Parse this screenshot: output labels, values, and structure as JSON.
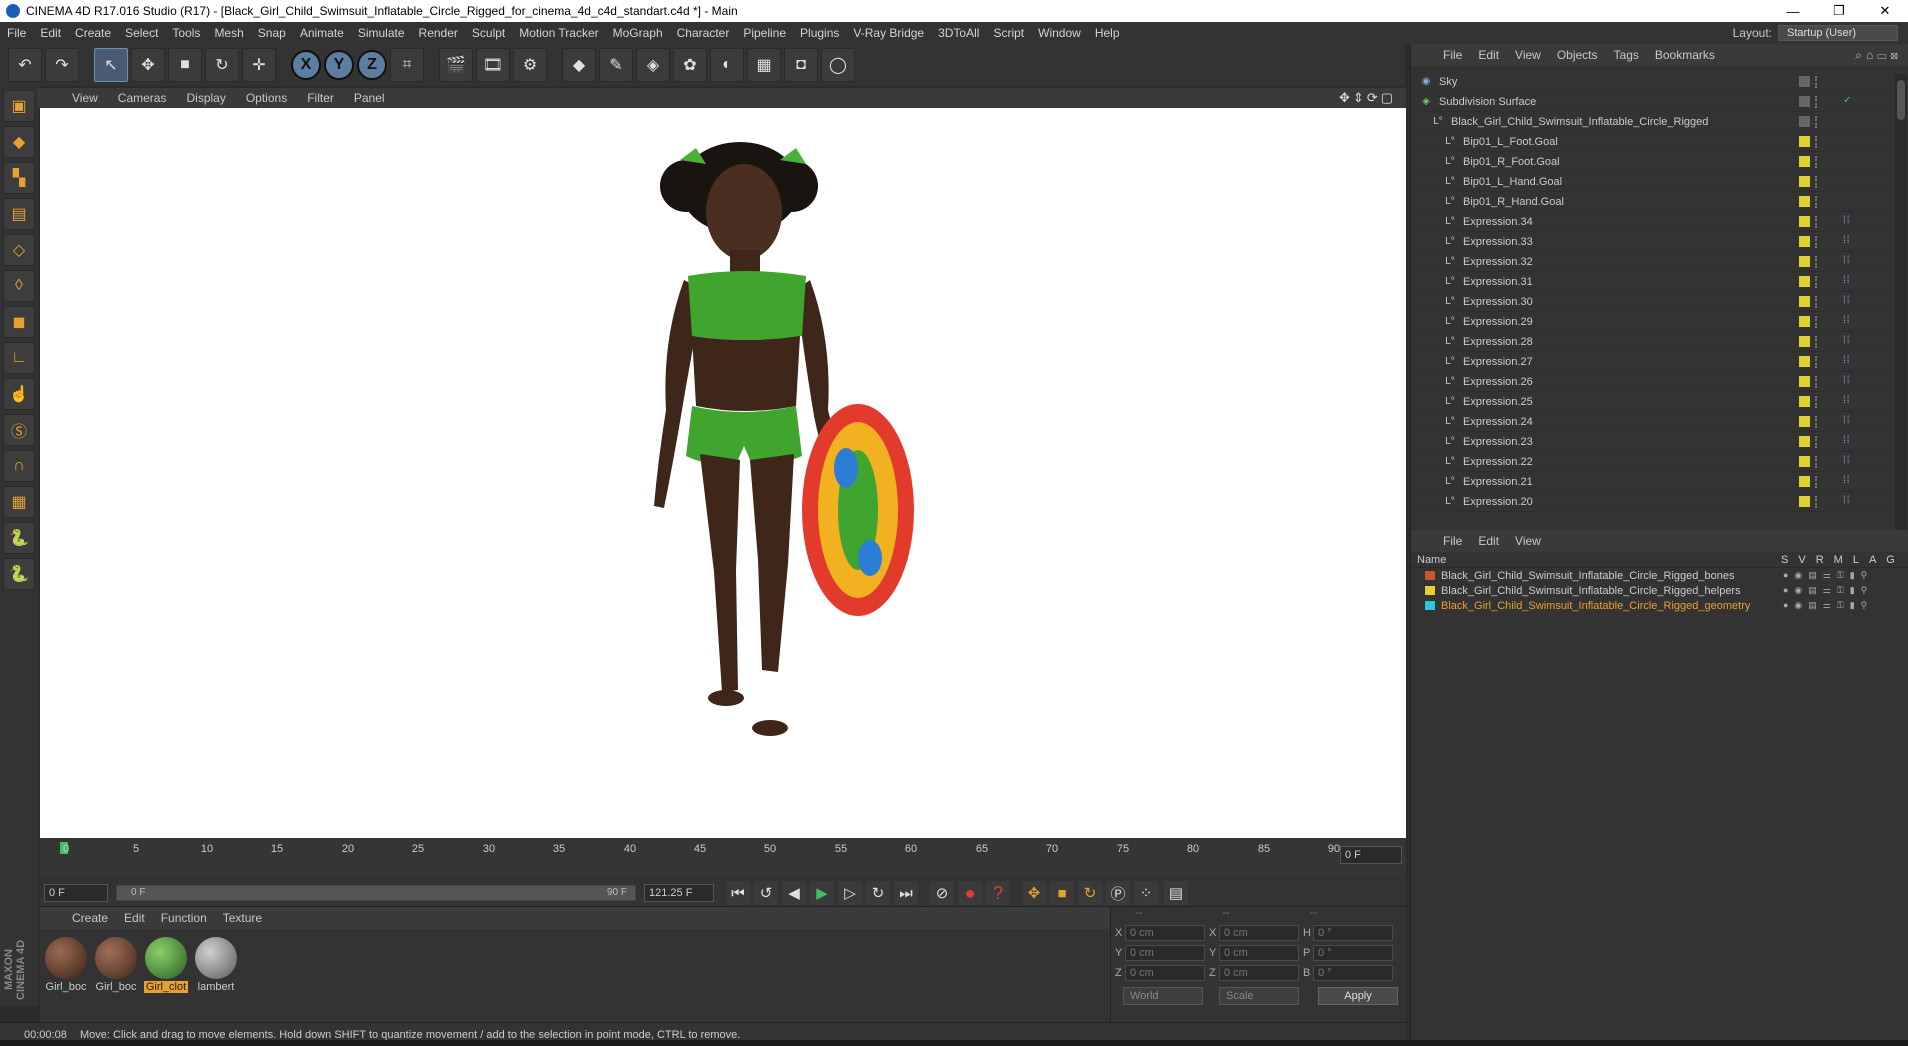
{
  "window": {
    "title": "CINEMA 4D R17.016 Studio (R17) - [Black_Girl_Child_Swimsuit_Inflatable_Circle_Rigged_for_cinema_4d_c4d_standart.c4d *] - Main",
    "min": "—",
    "restore": "❐",
    "close": "✕"
  },
  "menu": [
    "File",
    "Edit",
    "Create",
    "Select",
    "Tools",
    "Mesh",
    "Snap",
    "Animate",
    "Simulate",
    "Render",
    "Sculpt",
    "Motion Tracker",
    "MoGraph",
    "Character",
    "Pipeline",
    "Plugins",
    "V-Ray Bridge",
    "3DToAll",
    "Script",
    "Window",
    "Help"
  ],
  "layout": {
    "label": "Layout:",
    "value": "Startup (User)"
  },
  "toolbar": {
    "axis_x": "X",
    "axis_y": "Y",
    "axis_z": "Z"
  },
  "viewport_menu": [
    "View",
    "Cameras",
    "Display",
    "Options",
    "Filter",
    "Panel"
  ],
  "timeline": {
    "ticks": [
      "0",
      "5",
      "10",
      "15",
      "20",
      "25",
      "30",
      "35",
      "40",
      "45",
      "50",
      "55",
      "60",
      "65",
      "70",
      "75",
      "80",
      "85",
      "90"
    ],
    "frame_end": "0 F"
  },
  "transport": {
    "start": "0 F",
    "range_start": "0 F",
    "range_end": "90 F",
    "fps": "121.25 F"
  },
  "material_menu": [
    "Create",
    "Edit",
    "Function",
    "Texture"
  ],
  "materials": [
    {
      "label": "Girl_boc",
      "color": "#5a3a2a"
    },
    {
      "label": "Girl_boc",
      "color": "#6a4030"
    },
    {
      "label": "Girl_clot",
      "color": "#3e8a2e",
      "selected": true
    },
    {
      "label": "lambert",
      "color": "#8a8a8a"
    }
  ],
  "coords": {
    "headers": [
      "--",
      "--",
      "--"
    ],
    "rows": [
      {
        "a": "X",
        "av": "0 cm",
        "b": "X",
        "bv": "0 cm",
        "c": "H",
        "cv": "0 °"
      },
      {
        "a": "Y",
        "av": "0 cm",
        "b": "Y",
        "bv": "0 cm",
        "c": "P",
        "cv": "0 °"
      },
      {
        "a": "Z",
        "av": "0 cm",
        "b": "Z",
        "bv": "0 cm",
        "c": "B",
        "cv": "0 °"
      }
    ],
    "mode": "World",
    "size": "Scale",
    "apply": "Apply"
  },
  "status": {
    "time": "00:00:08",
    "text": "Move: Click and drag to move elements. Hold down SHIFT to quantize movement / add to the selection in point mode, CTRL to remove."
  },
  "objects_menu": [
    "File",
    "Edit",
    "View",
    "Objects",
    "Tags",
    "Bookmarks"
  ],
  "objects": [
    {
      "name": "Sky",
      "indent": 0,
      "icon": "sky"
    },
    {
      "name": "Subdivision Surface",
      "indent": 0,
      "icon": "subd",
      "check": "✓"
    },
    {
      "name": "Black_Girl_Child_Swimsuit_Inflatable_Circle_Rigged",
      "indent": 1,
      "icon": "null"
    },
    {
      "name": "Bip01_L_Foot.Goal",
      "indent": 2,
      "icon": "null",
      "yellow": true
    },
    {
      "name": "Bip01_R_Foot.Goal",
      "indent": 2,
      "icon": "null",
      "yellow": true
    },
    {
      "name": "Bip01_L_Hand.Goal",
      "indent": 2,
      "icon": "null",
      "yellow": true
    },
    {
      "name": "Bip01_R_Hand.Goal",
      "indent": 2,
      "icon": "null",
      "yellow": true
    },
    {
      "name": "Expression.34",
      "indent": 2,
      "icon": "null",
      "yellow": true,
      "tag": true
    },
    {
      "name": "Expression.33",
      "indent": 2,
      "icon": "null",
      "yellow": true,
      "tag": true
    },
    {
      "name": "Expression.32",
      "indent": 2,
      "icon": "null",
      "yellow": true,
      "tag": true
    },
    {
      "name": "Expression.31",
      "indent": 2,
      "icon": "null",
      "yellow": true,
      "tag": true
    },
    {
      "name": "Expression.30",
      "indent": 2,
      "icon": "null",
      "yellow": true,
      "tag": true
    },
    {
      "name": "Expression.29",
      "indent": 2,
      "icon": "null",
      "yellow": true,
      "tag": true
    },
    {
      "name": "Expression.28",
      "indent": 2,
      "icon": "null",
      "yellow": true,
      "tag": true
    },
    {
      "name": "Expression.27",
      "indent": 2,
      "icon": "null",
      "yellow": true,
      "tag": true
    },
    {
      "name": "Expression.26",
      "indent": 2,
      "icon": "null",
      "yellow": true,
      "tag": true
    },
    {
      "name": "Expression.25",
      "indent": 2,
      "icon": "null",
      "yellow": true,
      "tag": true
    },
    {
      "name": "Expression.24",
      "indent": 2,
      "icon": "null",
      "yellow": true,
      "tag": true
    },
    {
      "name": "Expression.23",
      "indent": 2,
      "icon": "null",
      "yellow": true,
      "tag": true
    },
    {
      "name": "Expression.22",
      "indent": 2,
      "icon": "null",
      "yellow": true,
      "tag": true
    },
    {
      "name": "Expression.21",
      "indent": 2,
      "icon": "null",
      "yellow": true,
      "tag": true
    },
    {
      "name": "Expression.20",
      "indent": 2,
      "icon": "null",
      "yellow": true,
      "tag": true
    }
  ],
  "layers_menu": [
    "File",
    "Edit",
    "View"
  ],
  "layers_header": {
    "name": "Name",
    "cols": [
      "S",
      "V",
      "R",
      "M",
      "L",
      "A",
      "G"
    ]
  },
  "layers": [
    {
      "name": "Black_Girl_Child_Swimsuit_Inflatable_Circle_Rigged_bones",
      "color": "#c8582a",
      "active": false
    },
    {
      "name": "Black_Girl_Child_Swimsuit_Inflatable_Circle_Rigged_helpers",
      "color": "#e0d030",
      "active": false
    },
    {
      "name": "Black_Girl_Child_Swimsuit_Inflatable_Circle_Rigged_geometry",
      "color": "#2ac8e0",
      "active": true
    }
  ]
}
